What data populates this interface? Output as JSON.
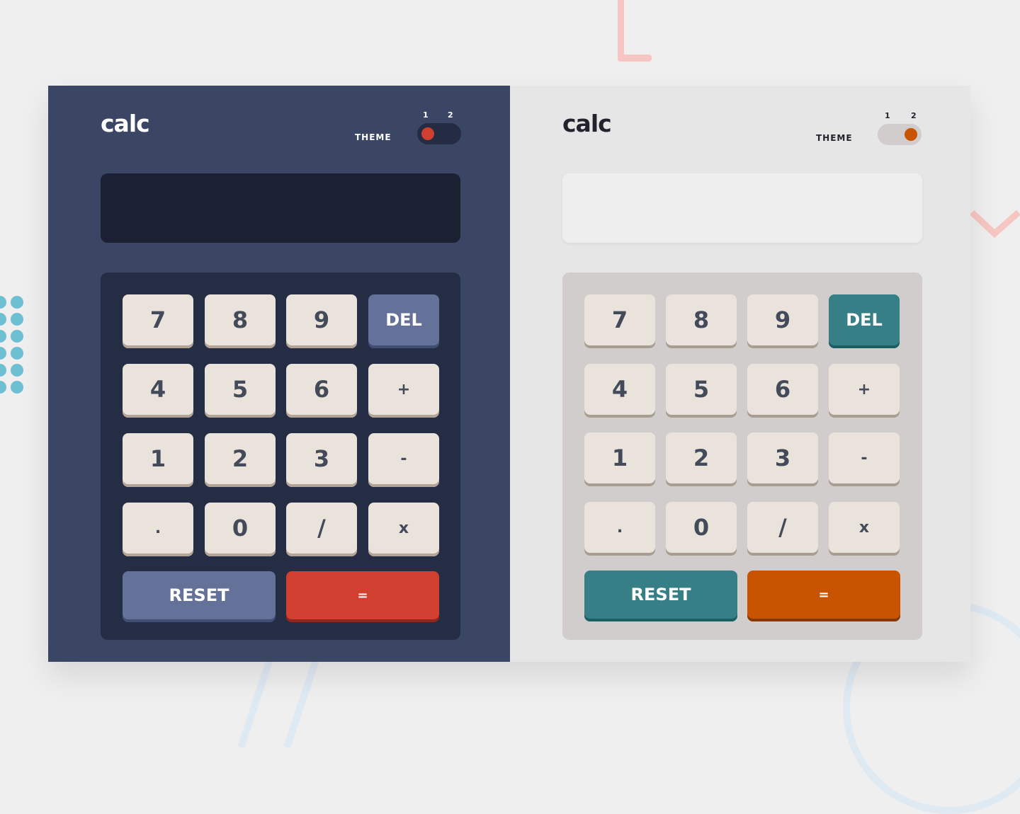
{
  "calculators": [
    {
      "logo": "calc",
      "theme_label": "THEME",
      "theme_numbers": [
        "1",
        "2"
      ],
      "active_theme": "1",
      "display_value": "",
      "keys": {
        "row1": [
          "7",
          "8",
          "9",
          "DEL"
        ],
        "row2": [
          "4",
          "5",
          "6",
          "+"
        ],
        "row3": [
          "1",
          "2",
          "3",
          "-"
        ],
        "row4": [
          ".",
          "0",
          "/",
          "x"
        ],
        "reset": "RESET",
        "equals": "="
      }
    },
    {
      "logo": "calc",
      "theme_label": "THEME",
      "theme_numbers": [
        "1",
        "2"
      ],
      "active_theme": "2",
      "display_value": "",
      "keys": {
        "row1": [
          "7",
          "8",
          "9",
          "DEL"
        ],
        "row2": [
          "4",
          "5",
          "6",
          "+"
        ],
        "row3": [
          "1",
          "2",
          "3",
          "-"
        ],
        "row4": [
          ".",
          "0",
          "/",
          "x"
        ],
        "reset": "RESET",
        "equals": "="
      }
    }
  ],
  "colors": {
    "theme1_main_bg": "#3b4664",
    "theme1_screen_bg": "#1c2033",
    "theme1_keypad_bg": "#252d44",
    "theme1_accent_key": "#647198",
    "theme1_equals_key": "#d03f2f",
    "theme2_main_bg": "#e6e6e6",
    "theme2_screen_bg": "#eeeeee",
    "theme2_keypad_bg": "#d2cdcd",
    "theme2_accent_key": "#377f86",
    "theme2_equals_key": "#c85402",
    "number_key": "#eae3dc",
    "number_key_text": "#434a59"
  }
}
